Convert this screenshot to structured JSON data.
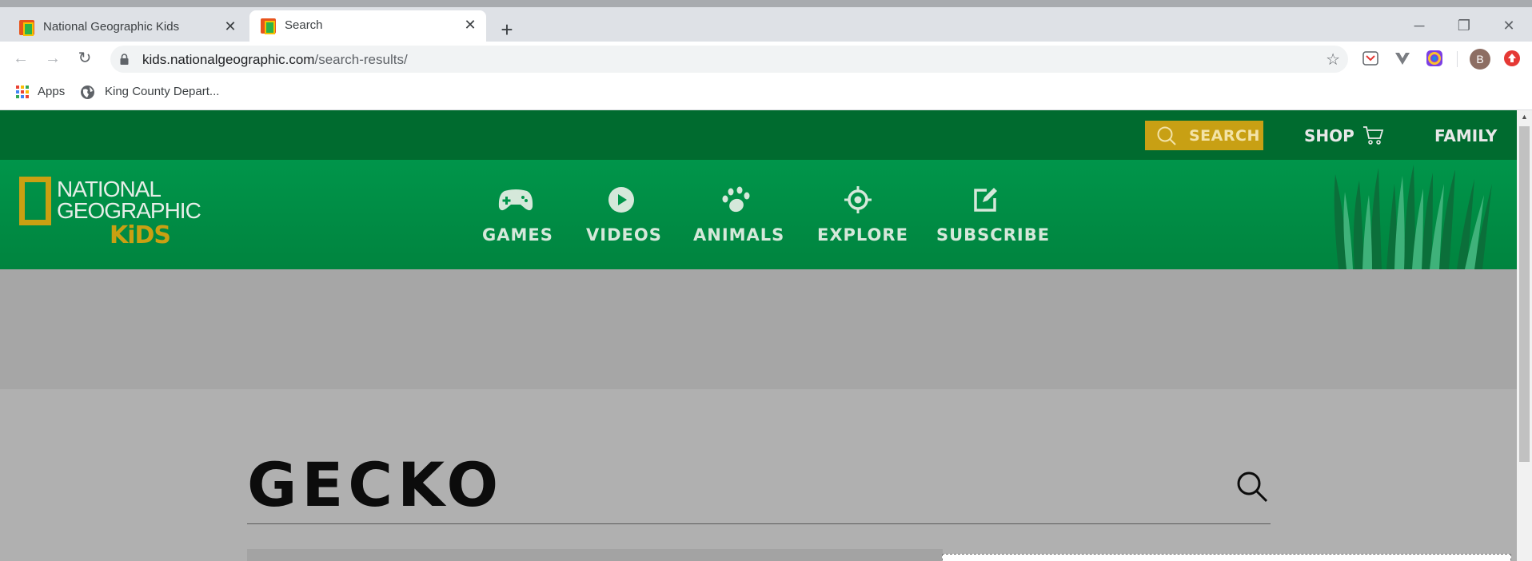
{
  "browser": {
    "tabs": [
      {
        "title": "National Geographic Kids",
        "active": false
      },
      {
        "title": "Search",
        "active": true
      }
    ],
    "new_tab": "+",
    "window_controls": {
      "minimize": "─",
      "restore": "❐",
      "close": "✕"
    },
    "nav": {
      "back": "←",
      "forward": "→",
      "reload": "↻"
    },
    "url_host": "kids.nationalgeographic.com",
    "url_path": "/search-results/",
    "bookmark_star": "☆",
    "profile_initial": "B",
    "bookmarks": [
      {
        "label": "Apps",
        "icon": "apps-grid-icon"
      },
      {
        "label": "King County Depart...",
        "icon": "globe-icon"
      }
    ]
  },
  "site": {
    "top_nav": {
      "search_label": "SEARCH",
      "shop_label": "SHOP",
      "family_label": "FAMILY"
    },
    "logo": {
      "line1": "NATIONAL",
      "line2": "GEOGRAPHIC",
      "line3": "KiDS"
    },
    "main_nav": [
      {
        "label": "GAMES",
        "icon": "gamepad-icon"
      },
      {
        "label": "VIDEOS",
        "icon": "play-icon"
      },
      {
        "label": "ANIMALS",
        "icon": "paw-icon"
      },
      {
        "label": "EXPLORE",
        "icon": "compass-icon"
      },
      {
        "label": "SUBSCRIBE",
        "icon": "edit-icon"
      }
    ],
    "colors": {
      "topbar": "#006b2f",
      "nav": "#00954a",
      "accent_gold": "#c8a014",
      "overlay_gray": "#b0b0b0"
    }
  },
  "search": {
    "query": "GECKO"
  }
}
